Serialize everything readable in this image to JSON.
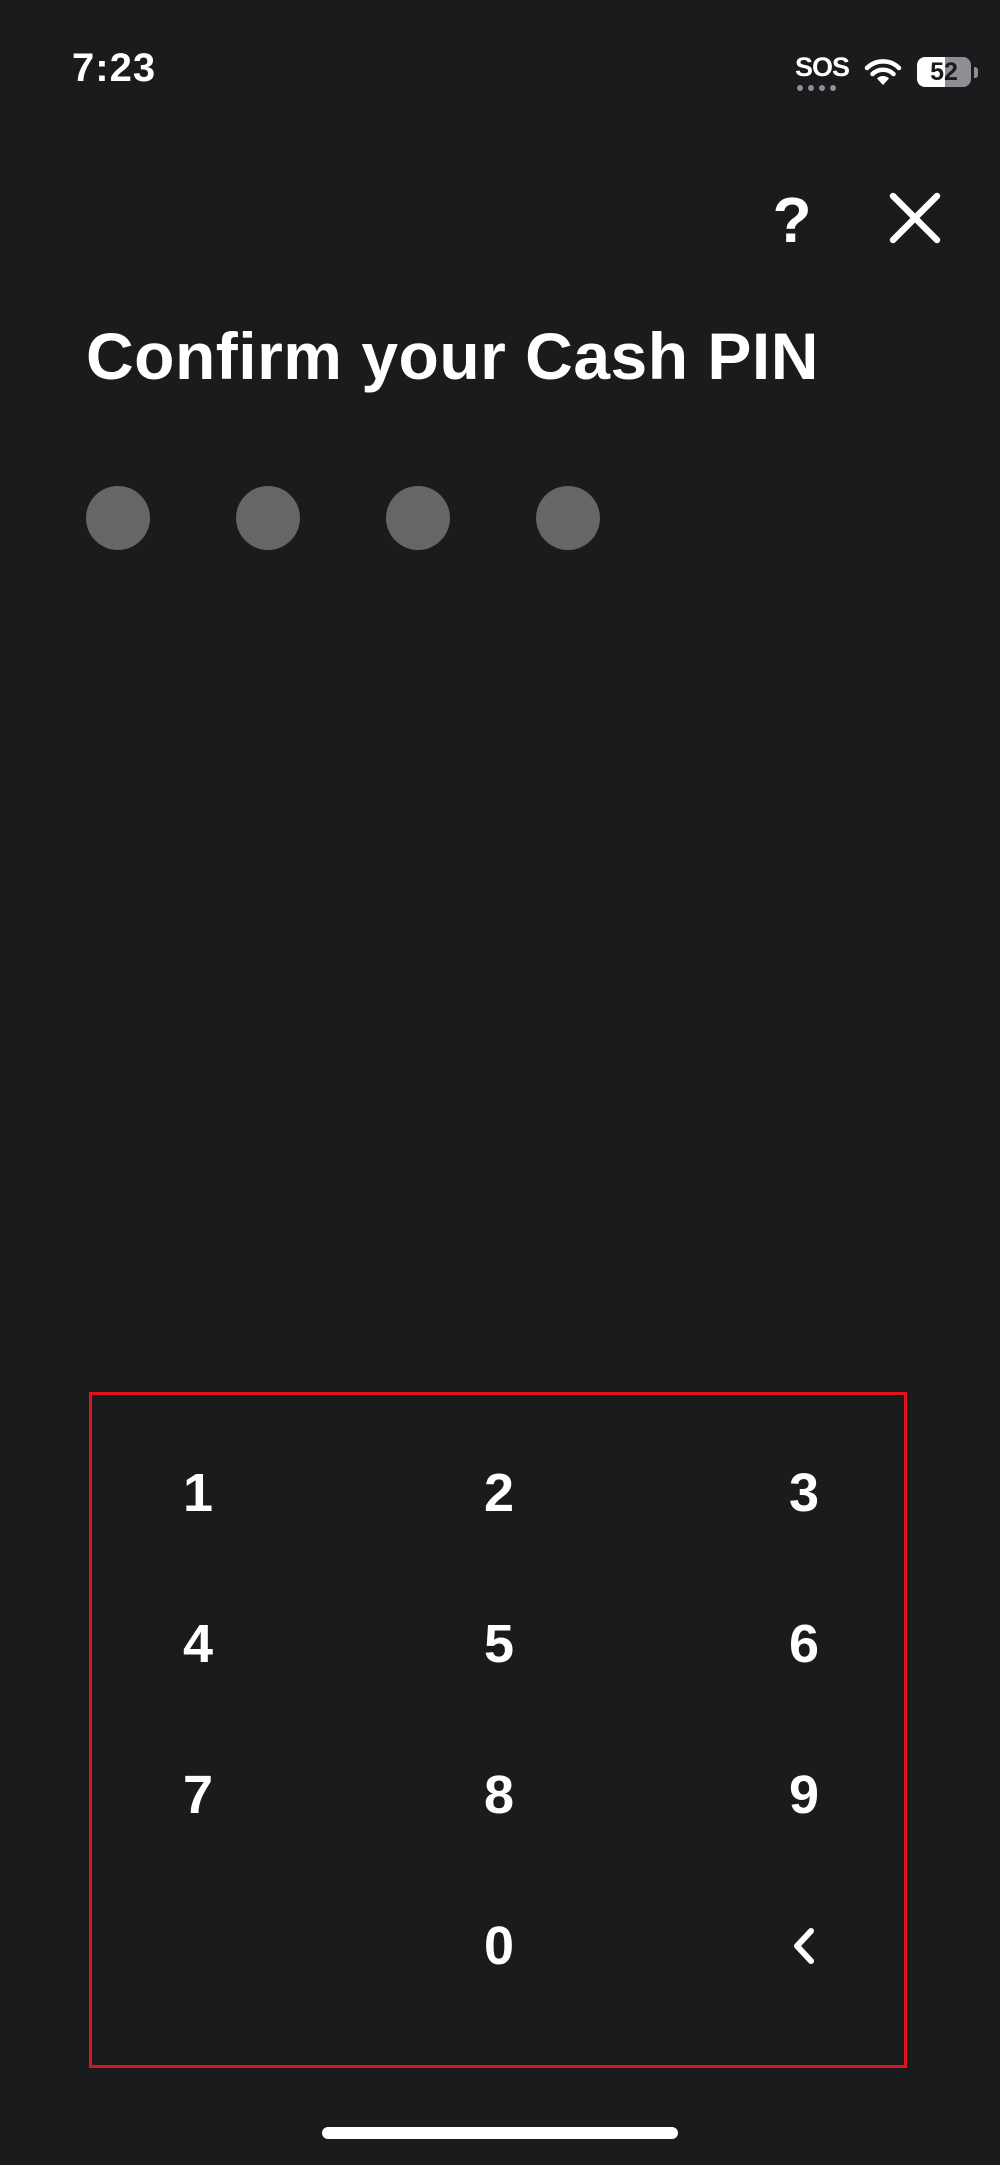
{
  "status_bar": {
    "time": "7:23",
    "sos": "SOS",
    "battery_level": "52",
    "battery_fraction": 0.52
  },
  "header": {
    "help_label": "?",
    "close_icon": "close-icon"
  },
  "title": "Confirm your Cash PIN",
  "pin": {
    "length": 4,
    "entered": 0
  },
  "keypad": {
    "keys": [
      "1",
      "2",
      "3",
      "4",
      "5",
      "6",
      "7",
      "8",
      "9",
      "0"
    ],
    "backspace_icon": "chevron-left-icon",
    "highlight_color": "#e3131b"
  },
  "colors": {
    "background": "#1a1b1d",
    "text": "#ffffff",
    "pin_dot_empty": "#666666"
  }
}
